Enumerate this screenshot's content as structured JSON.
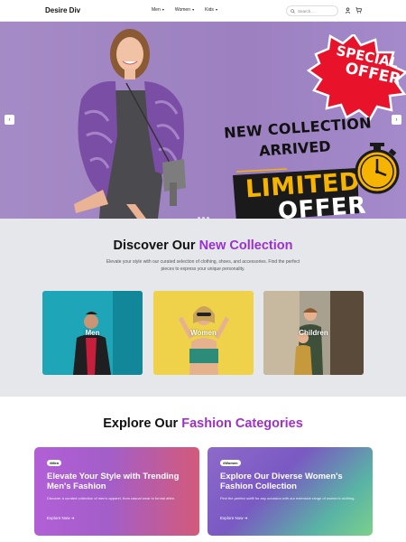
{
  "nav": {
    "brand": "Desire Div",
    "menu": [
      {
        "label": "Men"
      },
      {
        "label": "Women"
      },
      {
        "label": "Kids"
      }
    ],
    "search_placeholder": "Search..."
  },
  "hero": {
    "special": [
      "SPECIAL",
      "OFFER"
    ],
    "headline_1": "NEW COLLECTION",
    "headline_2": "ARRIVED",
    "limited": "LIMITED",
    "offer": "OFFER",
    "prev_icon": "chevron-left-icon",
    "next_icon": "chevron-right-icon"
  },
  "collection": {
    "title_plain": "Discover Our ",
    "title_accent": "New Collection",
    "subtitle": "Elevate your style with our curated selection of clothing, shoes, and accessories. Find the perfect pieces to express your unique personality.",
    "cards": [
      {
        "label": "Men"
      },
      {
        "label": "Women"
      },
      {
        "label": "Children"
      }
    ]
  },
  "fashion": {
    "title_plain": "Explore Our ",
    "title_accent": "Fashion Categories",
    "cards": [
      {
        "tag": "#Men",
        "title": "Elevate Your Style with Trending Men's Fashion",
        "desc": "Discover a curated collection of men's apparel, from casual wear to formal attire.",
        "link": "Explore Now"
      },
      {
        "tag": "#Women",
        "title": "Explore Our Diverse Women's Fashion Collection",
        "desc": "Find the perfect outfit for any occasion with our extensive range of women's clothing.",
        "link": "Explore Now"
      }
    ]
  },
  "colors": {
    "accent_purple": "#9b30d0",
    "hero_bg": "#a58bc6",
    "special_red": "#e8132b",
    "limited_yellow": "#f6b400"
  }
}
